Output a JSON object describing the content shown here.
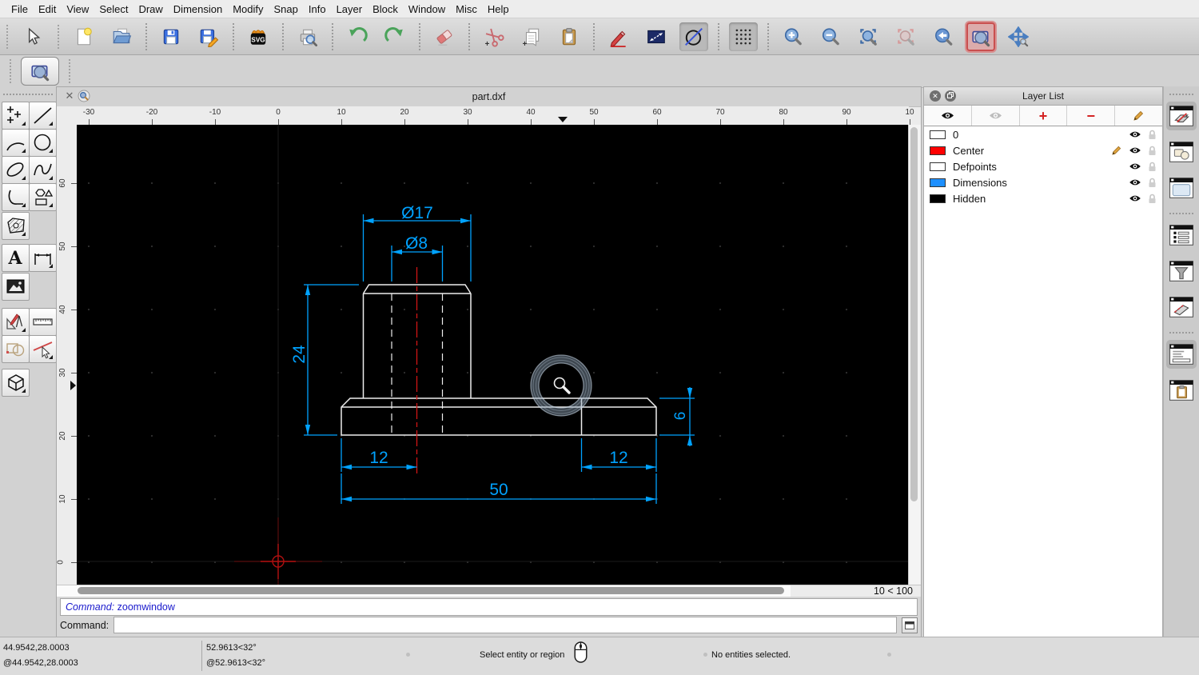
{
  "menu": {
    "items": [
      "File",
      "Edit",
      "View",
      "Select",
      "Draw",
      "Dimension",
      "Modify",
      "Snap",
      "Info",
      "Layer",
      "Block",
      "Window",
      "Misc",
      "Help"
    ]
  },
  "toolbar": {
    "buttons": [
      "selection-pointer",
      "new-document",
      "open-document",
      "save",
      "save-as",
      "export-svg",
      "print-preview",
      "undo",
      "redo",
      "eraser",
      "cut",
      "copy",
      "paste",
      "draw-pencil",
      "dimension-mode",
      "construction-mode",
      "grid-toggle",
      "zoom-in",
      "zoom-out",
      "zoom-auto",
      "zoom-selection",
      "zoom-previous",
      "zoom-window",
      "zoom-pan"
    ],
    "pressed_buttons": [
      "construction-mode",
      "grid-toggle"
    ],
    "active_button": "zoom-window"
  },
  "tool_options": {
    "active_tool": "zoom-window"
  },
  "document": {
    "title": "part.dxf",
    "scale_indicator": "10 < 100"
  },
  "rulers": {
    "horizontal": [
      "-30",
      "-20",
      "-10",
      "0",
      "10",
      "20",
      "30",
      "40",
      "50",
      "60",
      "70",
      "80",
      "90",
      "10"
    ],
    "vertical": [
      "60",
      "50",
      "40",
      "30",
      "20",
      "10",
      "0"
    ]
  },
  "drawing": {
    "dimensions": {
      "outer_diameter": "Ø17",
      "hole_diameter": "Ø8",
      "height": "24",
      "base_thickness": "6",
      "offset_left": "12",
      "offset_right": "12",
      "base_width": "50"
    },
    "colors": {
      "dimension": "#00A2FF",
      "geometry": "#EDEDED",
      "centerline": "#D01515"
    }
  },
  "layer_panel": {
    "title": "Layer List",
    "layers": [
      {
        "name": "0",
        "color": "#FFFFFF"
      },
      {
        "name": "Center",
        "color": "#FF0000"
      },
      {
        "name": "Defpoints",
        "color": "#FFFFFF"
      },
      {
        "name": "Dimensions",
        "color": "#1E90FF"
      },
      {
        "name": "Hidden",
        "color": "#000000"
      }
    ]
  },
  "command": {
    "history_label": "Command:",
    "history_entry": "zoomwindow",
    "prompt_label": "Command:",
    "input_value": ""
  },
  "status": {
    "abs_coord": "44.9542,28.0003",
    "rel_coord": "@44.9542,28.0003",
    "abs_polar": "52.9613<32°",
    "rel_polar": "@52.9613<32°",
    "hint": "Select entity or region",
    "selection_info": "No entities selected."
  }
}
